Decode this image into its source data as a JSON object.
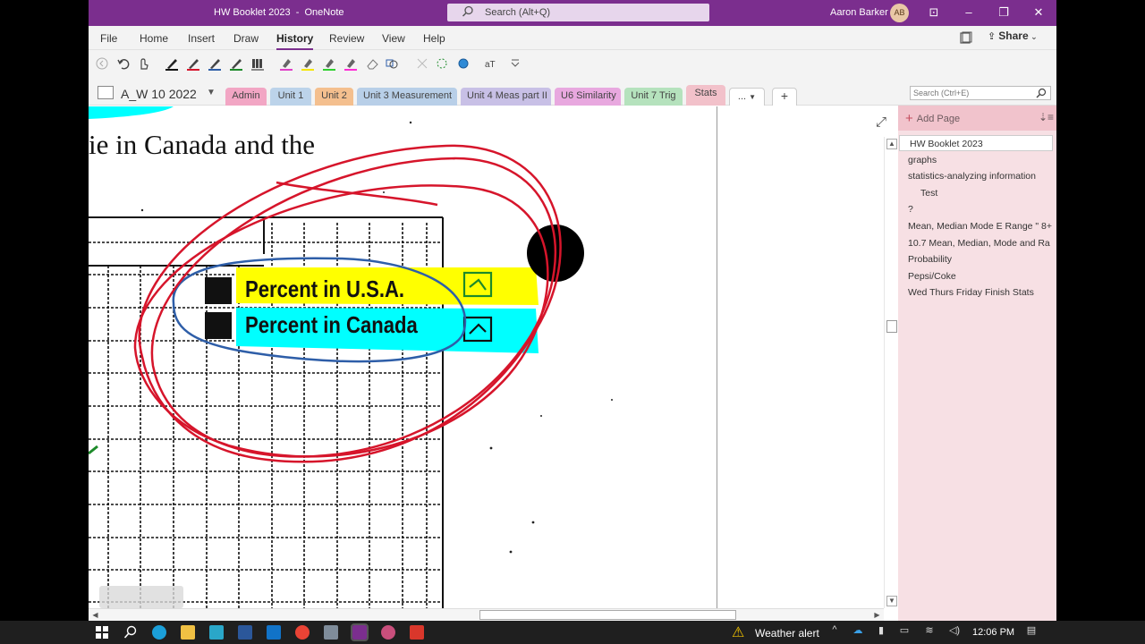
{
  "window": {
    "title": "HW Booklet 2023  -  OneNote",
    "search_placeholder": "Search (Alt+Q)",
    "user_name": "Aaron Barker",
    "user_initials": "AB"
  },
  "menu": {
    "items": [
      "File",
      "Home",
      "Insert",
      "Draw",
      "History",
      "Review",
      "View",
      "Help"
    ],
    "active": "History",
    "share_label": "Share"
  },
  "notebook": {
    "name": "A_W 10 2022",
    "sections": [
      {
        "label": "Admin",
        "color": "#f2a6c4"
      },
      {
        "label": "Unit 1",
        "color": "#bcd3ea"
      },
      {
        "label": "Unit 2",
        "color": "#f4bf8e"
      },
      {
        "label": "Unit 3 Measurement",
        "color": "#b8cfe8"
      },
      {
        "label": "Unit 4 Meas part II",
        "color": "#c8c0e6"
      },
      {
        "label": "U6 Similarity",
        "color": "#e8a8df"
      },
      {
        "label": "Unit 7 Trig",
        "color": "#b5e2bd"
      },
      {
        "label": "Stats",
        "color": "#f2c1ca"
      }
    ],
    "more_label": "...",
    "active_section": "Stats",
    "page_search_placeholder": "Search (Ctrl+E)"
  },
  "page_list": {
    "add_page_label": "Add Page",
    "pages": [
      {
        "title": "HW Booklet 2023",
        "level": 0,
        "selected": true
      },
      {
        "title": "graphs",
        "level": 0,
        "selected": false
      },
      {
        "title": "statistics-analyzing information",
        "level": 0,
        "selected": false
      },
      {
        "title": "Test",
        "level": 1,
        "selected": false
      },
      {
        "title": "?",
        "level": 0,
        "selected": false
      },
      {
        "title": "Mean, Median Mode E Range \" 8+",
        "level": 0,
        "selected": false
      },
      {
        "title": "10.7 Mean, Median, Mode and Ra",
        "level": 0,
        "selected": false
      },
      {
        "title": "Probability",
        "level": 0,
        "selected": false
      },
      {
        "title": "Pepsi/Coke",
        "level": 0,
        "selected": false
      },
      {
        "title": "Wed Thurs Friday  Finish Stats",
        "level": 0,
        "selected": false
      }
    ]
  },
  "canvas": {
    "heading": "ie in Canada and the",
    "legend_usa": "Percent in U.S.A.",
    "legend_canada": "Percent in Canada",
    "ink_colors": {
      "red": "#d6152b",
      "blue": "#2e5ea8",
      "green": "#1d8a2a",
      "yellow": "#ffff00",
      "cyan": "#00ffff"
    }
  },
  "taskbar": {
    "weather_label": "Weather alert",
    "time": "12:06 PM"
  }
}
